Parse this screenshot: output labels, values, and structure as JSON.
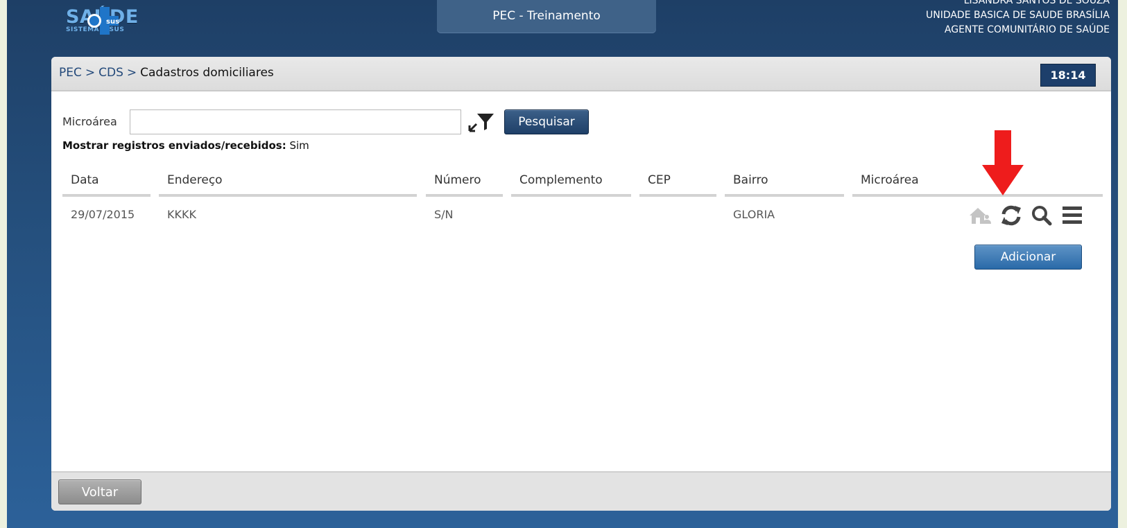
{
  "header": {
    "logo_text": "SAÚDE",
    "logo_subtext": "SISTEMA E-SUS",
    "logo_badge": "sus",
    "environment": "PEC - Treinamento",
    "user_name": "LISANDRA SANTOS DE SOUZA",
    "user_unit": "UNIDADE BASICA DE SAUDE BRASÍLIA",
    "user_role": "AGENTE COMUNITÁRIO DE SAÚDE"
  },
  "breadcrumb": {
    "items": [
      "PEC",
      "CDS"
    ],
    "separator": ">",
    "current": "Cadastros domiciliares"
  },
  "clock": "18:14",
  "filter": {
    "label": "Microárea",
    "value": "",
    "placeholder": "",
    "search_label": "Pesquisar",
    "show_sent_label": "Mostrar registros enviados/recebidos:",
    "show_sent_value": "Sim"
  },
  "table": {
    "columns": [
      "Data",
      "Endereço",
      "Número",
      "Complemento",
      "CEP",
      "Bairro",
      "Microárea"
    ],
    "rows": [
      [
        "29/07/2015",
        "KKKK",
        "S/N",
        "",
        "",
        "GLORIA",
        ""
      ]
    ]
  },
  "row_action_icons": [
    "house-people-icon",
    "refresh-icon",
    "search-icon",
    "menu-icon"
  ],
  "annotation": {
    "arrow_color": "#ee1c1c"
  },
  "actions": {
    "add_label": "Adicionar",
    "back_label": "Voltar"
  },
  "colors": {
    "header_bg": "#25507e",
    "primary_button": "#2a6aa8",
    "dark_button": "#1f4068"
  }
}
